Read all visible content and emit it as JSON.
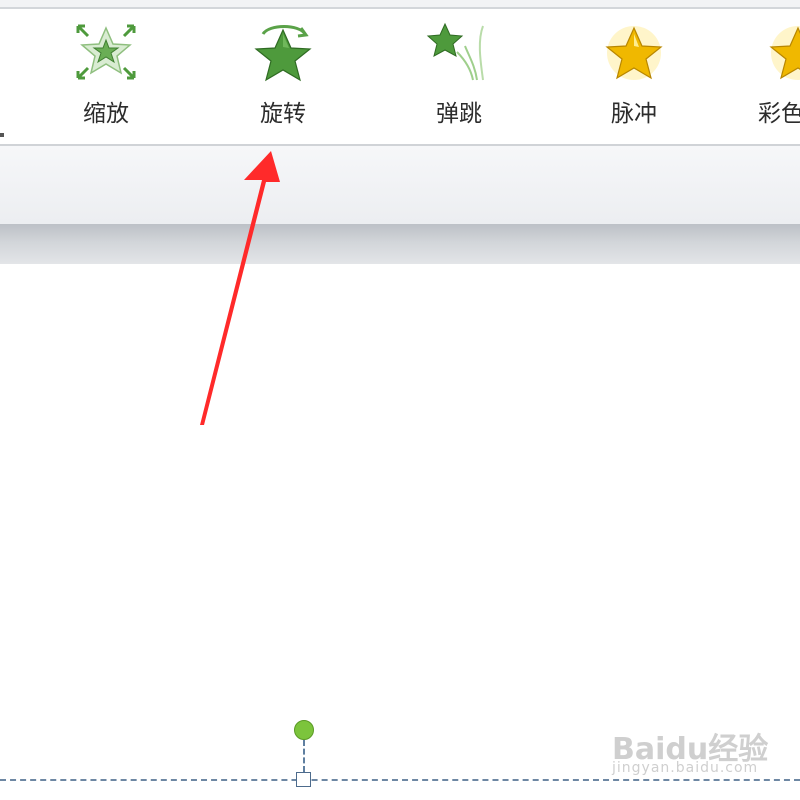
{
  "ribbon": {
    "effects": [
      {
        "label": "缩放",
        "icon": "zoom-star-icon"
      },
      {
        "label": "旋转",
        "icon": "spin-star-icon"
      },
      {
        "label": "弹跳",
        "icon": "bounce-star-icon"
      },
      {
        "label": "脉冲",
        "icon": "pulse-star-icon"
      },
      {
        "label": "彩色",
        "icon": "color-pulse-star-icon"
      }
    ]
  },
  "annotation": {
    "arrow_color": "#ff2a2a"
  },
  "colors": {
    "star_green": "#4e9a3c",
    "star_gold": "#f0b800",
    "rotation_handle": "#7cc43c"
  },
  "watermark": {
    "main": "Baidu经验",
    "sub": "jingyan.baidu.com"
  }
}
